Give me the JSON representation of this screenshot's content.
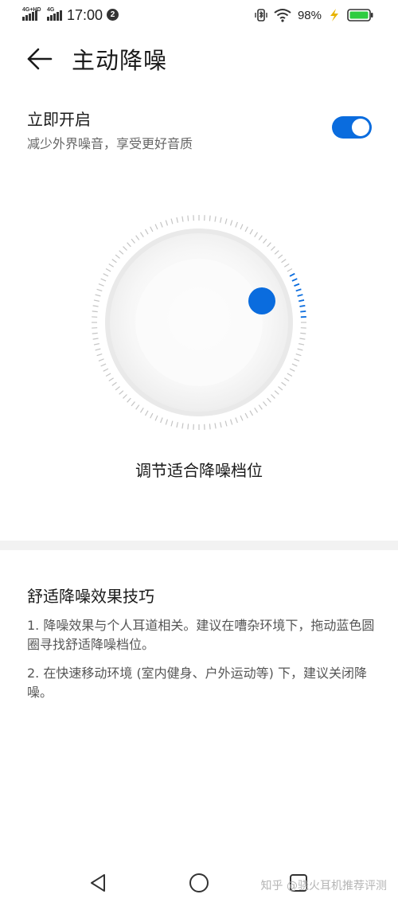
{
  "status_bar": {
    "sim1_label": "4G+HD",
    "sim2_label": "4G",
    "time": "17:00",
    "notification_count": "2",
    "battery_percent": "98%"
  },
  "header": {
    "title": "主动降噪"
  },
  "toggle": {
    "title": "立即开启",
    "subtitle": "减少外界噪音，享受更好音质",
    "enabled": true,
    "accent_color": "#0a6cde"
  },
  "dial": {
    "caption": "调节适合降噪档位",
    "knob_color": "#0a6cde"
  },
  "tips": {
    "title": "舒适降噪效果技巧",
    "items": [
      "1. 降噪效果与个人耳道相关。建议在嘈杂环境下，拖动蓝色圆圈寻找舒适降噪档位。",
      "2. 在快速移动环境 (室内健身、户外运动等) 下，建议关闭降噪。"
    ]
  },
  "nav_bar": {
    "watermark": "知乎 @骁火耳机推荐评测"
  }
}
